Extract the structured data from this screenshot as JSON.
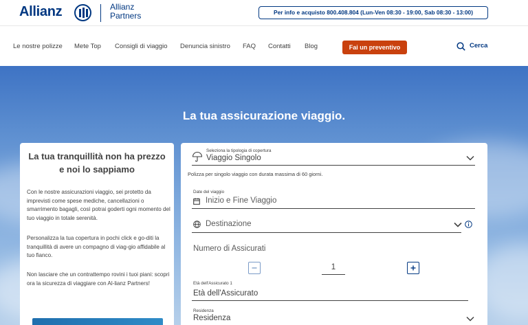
{
  "header": {
    "logo_text": "Allianz",
    "partners_line1": "Allianz",
    "partners_line2": "Partners",
    "info_text": "Per info e acquisto 800.408.804 (Lun-Ven 08:30 - 19:00, Sab 08:30 - 13:00)"
  },
  "nav": {
    "items": [
      "Le nostre polizze",
      "Mete Top",
      "Consigli di viaggio",
      "Denuncia sinistro",
      "FAQ",
      "Contatti",
      "Blog"
    ],
    "cta_label": "Fai un preventivo",
    "search_label": "Cerca"
  },
  "hero": {
    "title": "La tua assicurazione viaggio."
  },
  "left_card": {
    "heading": "La tua tranquillità non ha prezzo e noi lo sappiamo",
    "paragraphs": [
      "Con le nostre assicurazioni viaggio, sei protetto da imprevisti come spese mediche, cancellazioni o smarrimento bagagli, così potrai goderti ogni momento del tuo viaggio in totale serenità.",
      "Personalizza la tua copertura in pochi click e go-diti la tranquillità di avere un compagno di viag-gio affidabile al tuo fianco.",
      "Non lasciare che un contrattempo rovini i tuoi piani: scopri ora la sicurezza di viaggiare con Al-lianz Partners!"
    ]
  },
  "form": {
    "coverage_label": "Seleziona la tipologia di copertura",
    "coverage_value": "Viaggio Singolo",
    "coverage_note": "Polizza per singolo viaggio con durata massima di 60 giorni.",
    "dates_label": "Date del viaggio",
    "dates_placeholder": "Inizio e Fine Viaggio",
    "destination_placeholder": "Destinazione",
    "insured_count_label": "Numero di Assicurati",
    "insured_count_value": "1",
    "age_label": "Età dell'Assicurato 1",
    "age_placeholder": "Età dell'Assicurato",
    "residence_label": "Residenza",
    "residence_value": "Residenza"
  },
  "colors": {
    "brand_blue": "#003781",
    "cta_orange": "#c9410e"
  }
}
